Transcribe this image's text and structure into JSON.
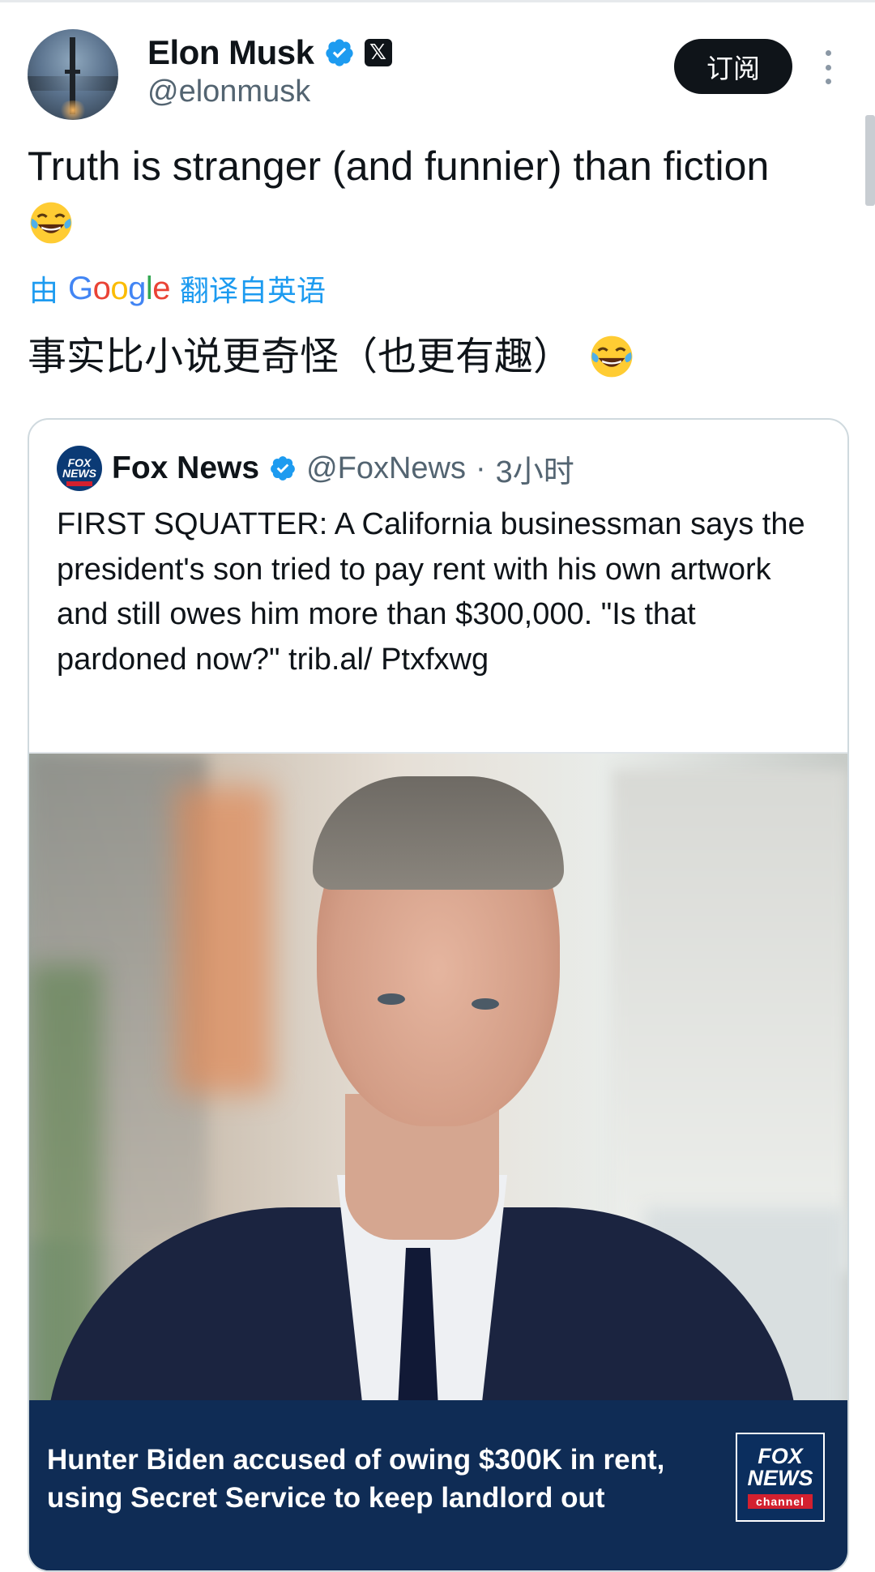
{
  "author": {
    "name": "Elon Musk",
    "handle": "@elonmusk",
    "x_badge": "𝕏"
  },
  "actions": {
    "subscribe_label": "订阅"
  },
  "tweet": {
    "text": "Truth is stranger (and funnier) than fiction",
    "emoji": "face-with-tears-of-joy-icon"
  },
  "translation": {
    "prefix": "由",
    "provider": "Google",
    "suffix": "翻译自英语",
    "text": "事实比小说更奇怪（也更有趣）"
  },
  "quoted_tweet": {
    "name": "Fox News",
    "handle": "@FoxNews",
    "separator": "·",
    "time": "3小时",
    "text": "FIRST SQUATTER: A California businessman says the president's son tried to pay rent with his own artwork and still owes him more than $300,000. \"Is that pardoned now?\" trib.al/ Ptxfxwg",
    "avatar_text": "FOX NEWS",
    "image_caption": "Hunter Biden accused of owing $300K in rent, using Secret Service to keep landlord out",
    "logo_text": "FOX NEWS",
    "logo_sub": "channel"
  },
  "colors": {
    "accent": "#1d9bf0",
    "text": "#0f1419",
    "muted": "#536471",
    "caption_bg": "#0f2c55"
  }
}
